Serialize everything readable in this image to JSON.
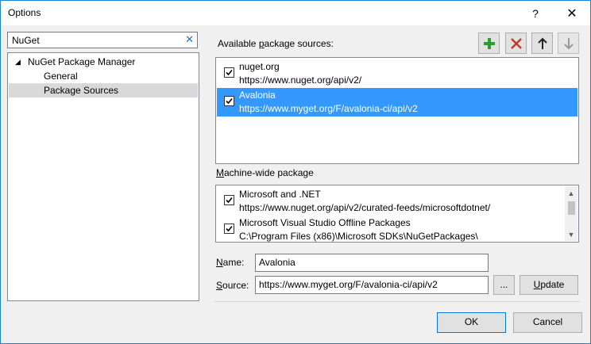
{
  "window": {
    "title": "Options",
    "help_label": "?",
    "close_label": "✕"
  },
  "search": {
    "value": "NuGet",
    "clear_label": "✕"
  },
  "tree": {
    "arrow": "◢",
    "items": [
      {
        "label": "NuGet Package Manager"
      },
      {
        "label": "General"
      },
      {
        "label": "Package Sources"
      }
    ]
  },
  "available": {
    "label_before": "Available ",
    "label_underlined": "p",
    "label_after": "ackage sources:",
    "sources": [
      {
        "name": "nuget.org",
        "url": "https://www.nuget.org/api/v2/",
        "checked": true
      },
      {
        "name": "Avalonia",
        "url": "https://www.myget.org/F/avalonia-ci/api/v2",
        "checked": true,
        "selected": true
      }
    ]
  },
  "toolbar": {
    "add_icon": "plus-icon",
    "add_color": "#2e9b2e",
    "remove_icon": "x-icon",
    "remove_color": "#c0392b",
    "up_icon": "arrow-up-icon",
    "down_icon": "arrow-down-icon"
  },
  "machine": {
    "label_underlined": "M",
    "label_after": "achine-wide package",
    "sources": [
      {
        "name": "Microsoft and .NET",
        "url": "https://www.nuget.org/api/v2/curated-feeds/microsoftdotnet/",
        "checked": true
      },
      {
        "name": "Microsoft Visual Studio Offline Packages",
        "url": "C:\\Program Files (x86)\\Microsoft SDKs\\NuGetPackages\\",
        "checked": true
      }
    ],
    "scroll_up": "▲",
    "scroll_down": "▼"
  },
  "form": {
    "name_label_underlined": "N",
    "name_label_after": "ame:",
    "name_value": "Avalonia",
    "source_label_underlined": "S",
    "source_label_after": "ource:",
    "source_value": "https://www.myget.org/F/avalonia-ci/api/v2",
    "browse_label": "...",
    "update_label_underlined": "U",
    "update_label_after": "pdate"
  },
  "footer": {
    "ok_label": "OK",
    "cancel_label": "Cancel"
  }
}
